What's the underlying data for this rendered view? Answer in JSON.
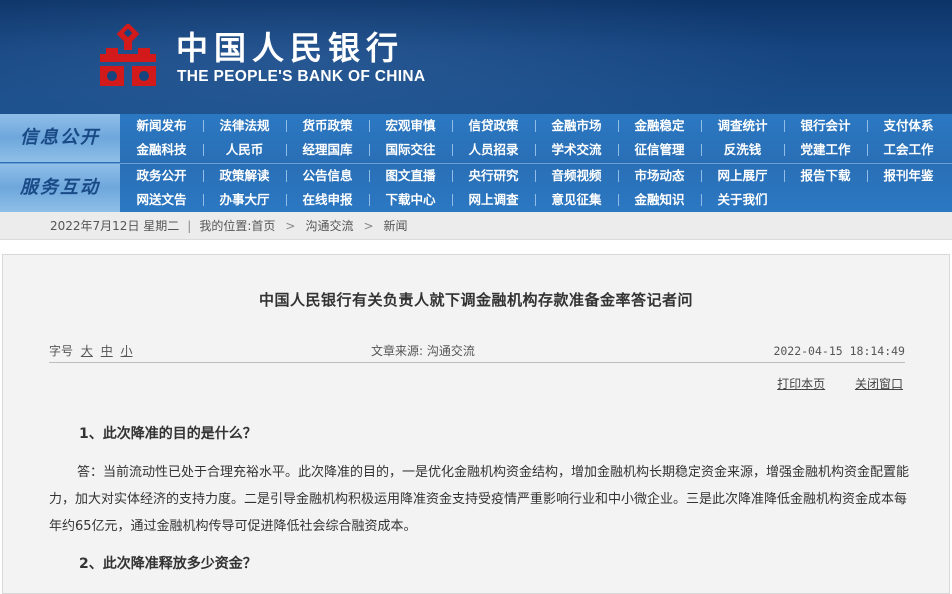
{
  "header": {
    "bank_name_cn": "中国人民银行",
    "bank_name_en": "THE PEOPLE'S BANK OF CHINA",
    "logo_icon": "pboc-logo-icon",
    "colors": {
      "banner": "#15447f",
      "logo": "#d21a1a",
      "nav": "#2b78c2"
    }
  },
  "nav": {
    "info_title": "信息公开",
    "service_title": "服务互动",
    "info_row1": [
      "新闻发布",
      "法律法规",
      "货币政策",
      "宏观审慎",
      "信贷政策",
      "金融市场",
      "金融稳定",
      "调查统计",
      "银行会计",
      "支付体系"
    ],
    "info_row2": [
      "金融科技",
      "人民币",
      "经理国库",
      "国际交往",
      "人员招录",
      "学术交流",
      "征信管理",
      "反洗钱",
      "党建工作",
      "工会工作"
    ],
    "service_row1": [
      "政务公开",
      "政策解读",
      "公告信息",
      "图文直播",
      "央行研究",
      "音频视频",
      "市场动态",
      "网上展厅",
      "报告下载",
      "报刊年鉴"
    ],
    "service_row2": [
      "网送文告",
      "办事大厅",
      "在线申报",
      "下载中心",
      "网上调查",
      "意见征集",
      "金融知识",
      "关于我们"
    ]
  },
  "breadcrumb": {
    "date": "2022年7月12日 星期二",
    "location_label": "我的位置:",
    "items": [
      "首页",
      "沟通交流",
      "新闻"
    ]
  },
  "article": {
    "title": "中国人民银行有关负责人就下调金融机构存款准备金率答记者问",
    "font_size_label": "字号",
    "font_sizes": [
      "大",
      "中",
      "小"
    ],
    "source": "文章来源: 沟通交流",
    "datetime": "2022-04-15 18:14:49",
    "print_label": "打印本页",
    "close_label": "关闭窗口",
    "q1": "1、此次降准的目的是什么？",
    "a1": "答：当前流动性已处于合理充裕水平。此次降准的目的，一是优化金融机构资金结构，增加金融机构长期稳定资金来源，增强金融机构资金配置能力，加大对实体经济的支持力度。二是引导金融机构积极运用降准资金支持受疫情严重影响行业和中小微企业。三是此次降准降低金融机构资金成本每年约65亿元，通过金融机构传导可促进降低社会综合融资成本。",
    "q2": "2、此次降准释放多少资金？"
  }
}
